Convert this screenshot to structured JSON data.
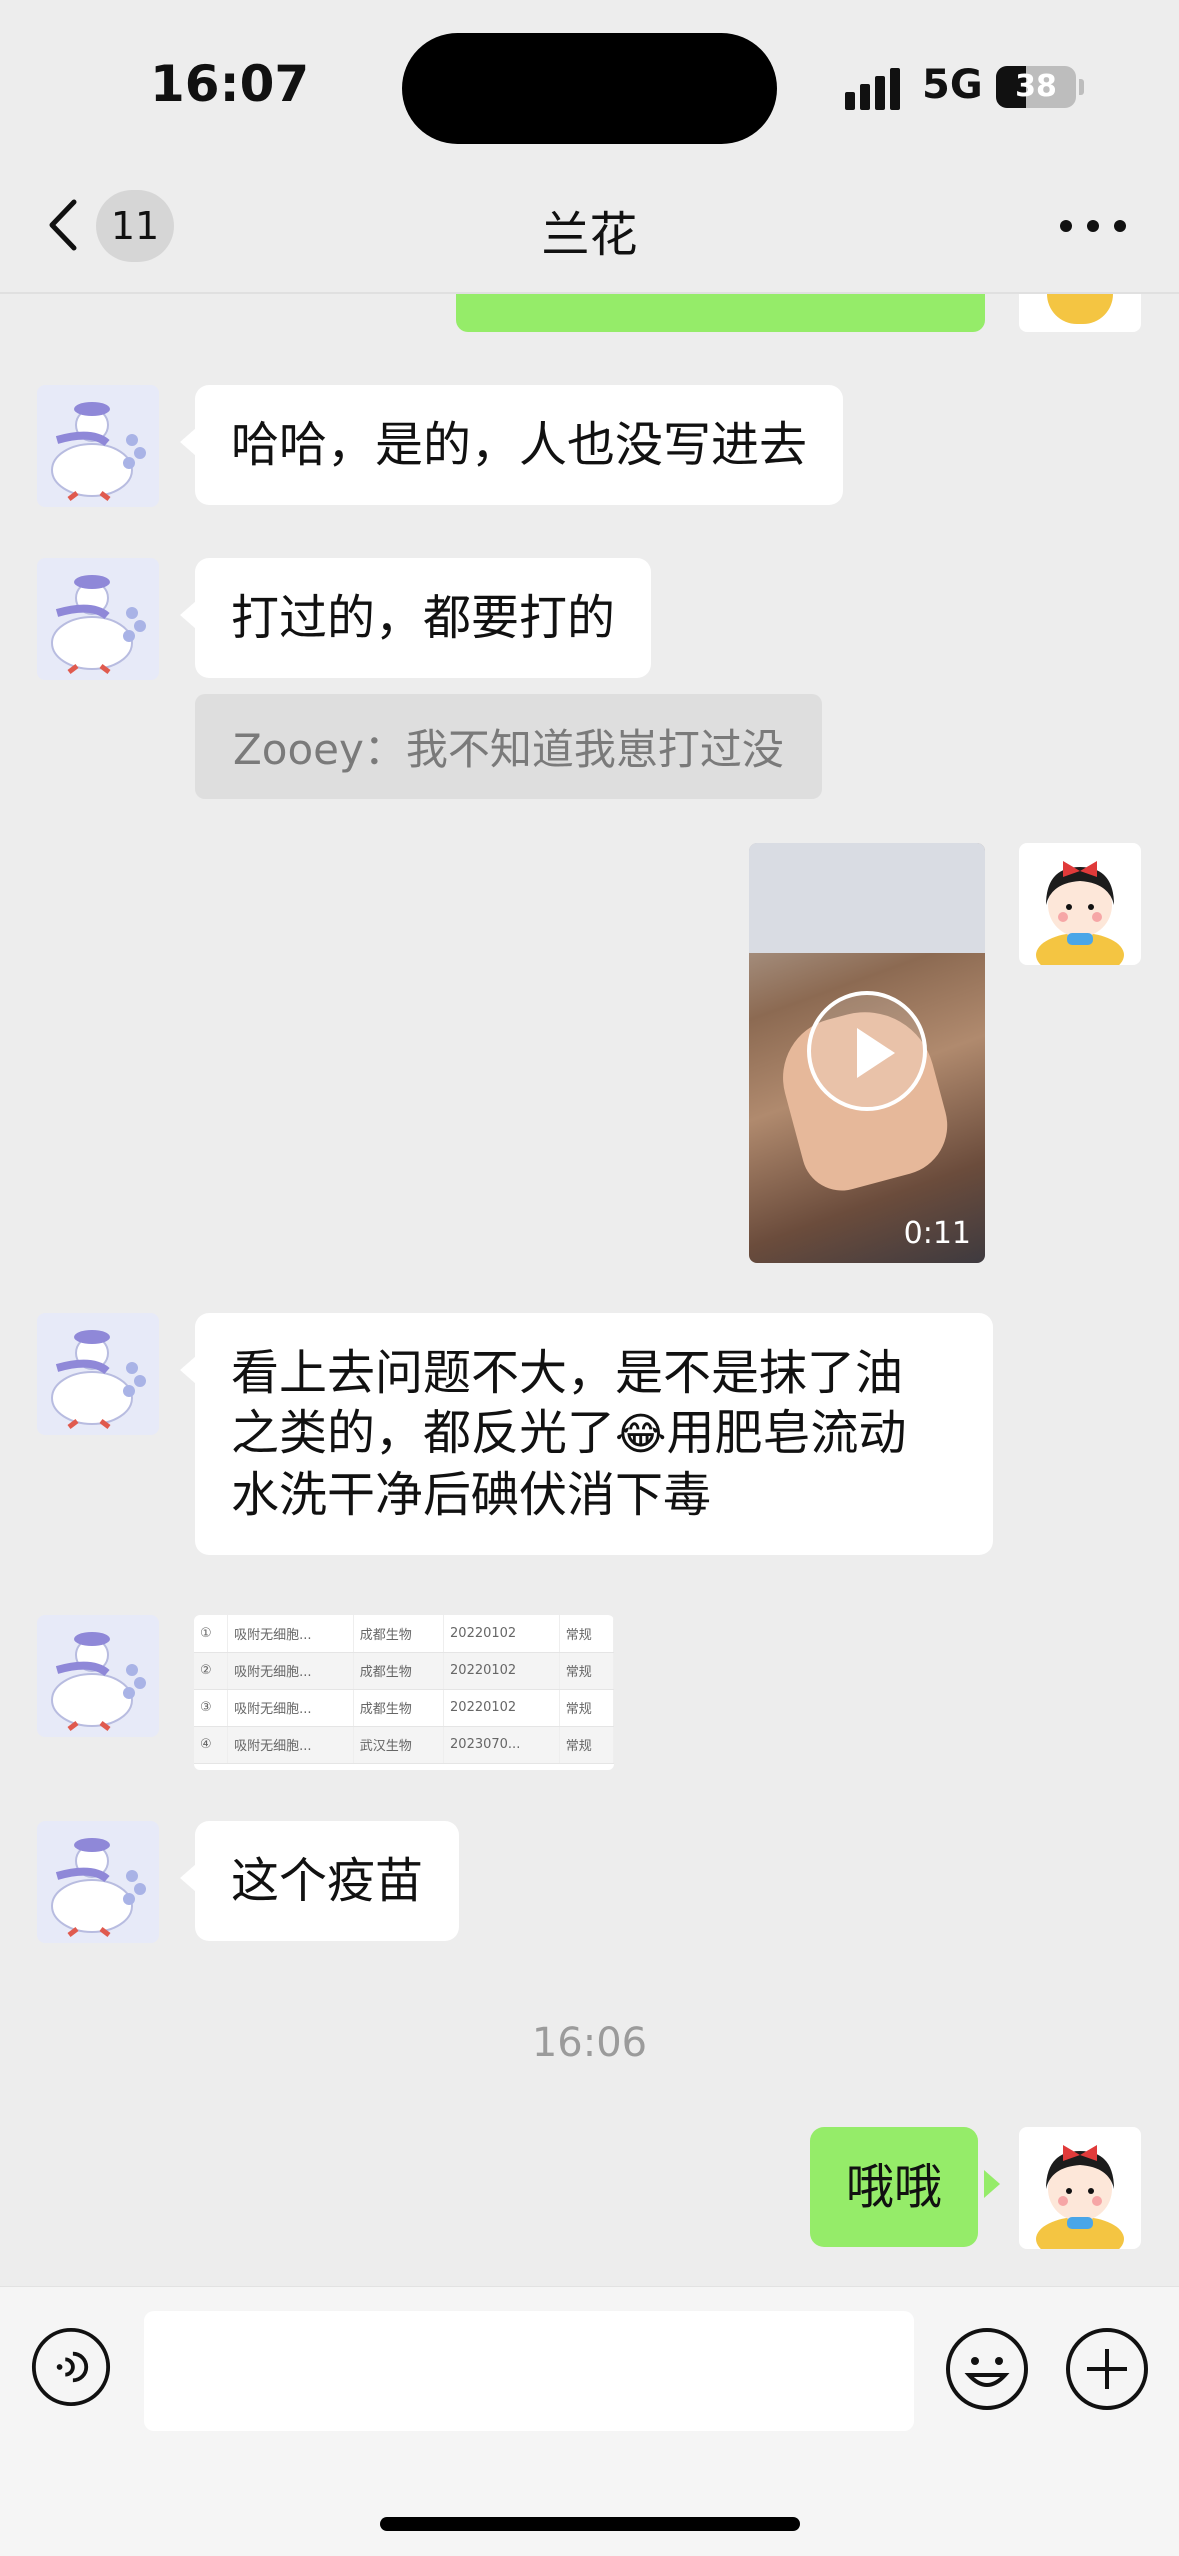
{
  "status_bar": {
    "time": "16:07",
    "network": "5G",
    "battery": "38"
  },
  "nav": {
    "back_badge": "11",
    "title": "兰花"
  },
  "messages": [
    {
      "sender": "other",
      "text": "哈哈，是的，人也没写进去"
    },
    {
      "sender": "other",
      "text": "打过的，都要打的",
      "quote": "Zooey：我不知道我崽打过没"
    },
    {
      "sender": "me",
      "type": "video",
      "duration": "0:11"
    },
    {
      "sender": "other",
      "lines": [
        "看上去问题不大，是不是抹了油",
        "之类的，都反光了",
        "用肥皂流动",
        "水洗干净后碘伏消下毒"
      ],
      "emoji": "😂"
    },
    {
      "sender": "other",
      "type": "image",
      "table": [
        [
          "①",
          "吸附无细胞...",
          "成都生物",
          "20220102",
          "常规"
        ],
        [
          "②",
          "吸附无细胞...",
          "成都生物",
          "20220102",
          "常规"
        ],
        [
          "③",
          "吸附无细胞...",
          "成都生物",
          "20220102",
          "常规"
        ],
        [
          "④",
          "吸附无细胞...",
          "武汉生物",
          "2023070...",
          "常规"
        ]
      ]
    },
    {
      "sender": "other",
      "text": "这个疫苗"
    },
    {
      "sender": "me",
      "text": "哦哦"
    }
  ],
  "timestamp": "16:06",
  "colors": {
    "background": "#ededed",
    "bubble_out": "#95ec69",
    "bubble_in": "#ffffff"
  }
}
